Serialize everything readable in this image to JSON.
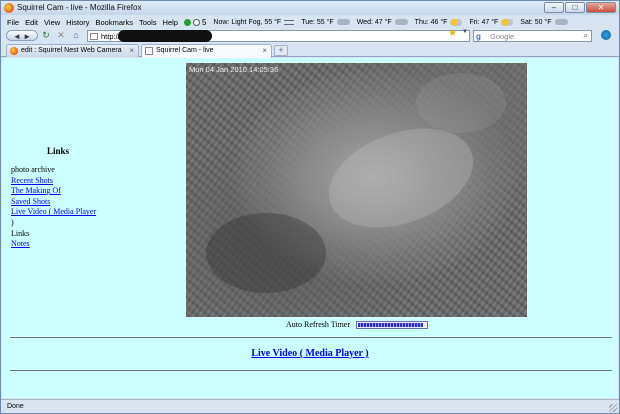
{
  "window": {
    "title": "Squirrel Cam - live - Mozilla Firefox",
    "controls": {
      "minimize": "–",
      "maximize": "□",
      "close": "✕"
    }
  },
  "menubar": {
    "items": [
      "File",
      "Edit",
      "View",
      "History",
      "Bookmarks",
      "Tools",
      "Help"
    ],
    "weather_count": "5",
    "weather": [
      {
        "label": "Now: Light Fog, 55 °F",
        "icon": "wind-icon"
      },
      {
        "label": "Tue: 55 °F",
        "icon": "cloud-icon"
      },
      {
        "label": "Wed: 47 °F",
        "icon": "cloud-icon"
      },
      {
        "label": "Thu: 46 °F",
        "icon": "partly-sunny-icon"
      },
      {
        "label": "Fri: 47 °F",
        "icon": "partly-sunny-icon"
      },
      {
        "label": "Sat: 50 °F",
        "icon": "cloud-icon"
      }
    ]
  },
  "navbar": {
    "back_forward": "◄ ►",
    "reload": "↻",
    "stop": "✕",
    "home": "⌂",
    "url_prefix": "http://",
    "search_engine": "g",
    "search_placeholder": "Google",
    "search_go": "⌕"
  },
  "tabs": [
    {
      "label": "edit : Squirrel Nest Web Camera",
      "active": false,
      "close": "×"
    },
    {
      "label": "Squirrel Cam - live",
      "active": true,
      "close": "×"
    }
  ],
  "newtab_label": "+",
  "page": {
    "background": "#ccffff",
    "links_heading": "Links",
    "sidebar": [
      {
        "text": "photo archive",
        "link": false
      },
      {
        "text": "Recent Shots",
        "link": true
      },
      {
        "text": "The Making Of",
        "link": true
      },
      {
        "text": "Saved Shots",
        "link": true
      },
      {
        "text": "Live Video ( Media Player",
        "link": true
      },
      {
        "text": ")",
        "link": false
      },
      {
        "text": "Links",
        "link": false
      },
      {
        "text": "Notes",
        "link": true
      }
    ],
    "camera_timestamp": "Mon 04 Jan 2010 14:05:36",
    "auto_refresh_label": "Auto Refresh Timer",
    "auto_refresh_progress": 0.95,
    "bottom_link": "Live Video ( Media Player )"
  },
  "status": {
    "text": "Done"
  },
  "colors": {
    "link": "#0000ee",
    "content_bg": "#ccffff",
    "chrome": "#d7e4f2"
  }
}
